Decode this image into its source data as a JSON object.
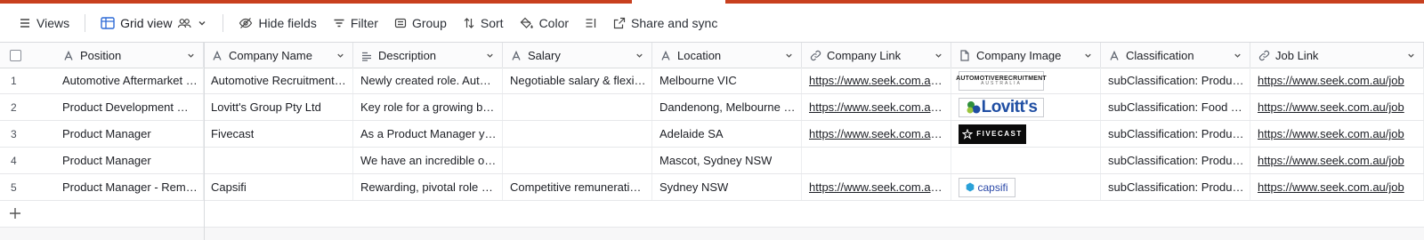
{
  "toolbar": {
    "views": "Views",
    "grid_view": "Grid view",
    "hide_fields": "Hide fields",
    "filter": "Filter",
    "group": "Group",
    "sort": "Sort",
    "color": "Color",
    "share_sync": "Share and sync"
  },
  "colors": {
    "accent": "#c8401f",
    "border": "#d9dbde",
    "grid_icon": "#2d6ad6"
  },
  "columns": [
    {
      "label": "Position",
      "icon": "text-type-icon"
    },
    {
      "label": "Company Name",
      "icon": "text-type-icon"
    },
    {
      "label": "Description",
      "icon": "long-text-icon"
    },
    {
      "label": "Salary",
      "icon": "text-type-icon"
    },
    {
      "label": "Location",
      "icon": "text-type-icon"
    },
    {
      "label": "Company Link",
      "icon": "link-icon"
    },
    {
      "label": "Company Image",
      "icon": "file-icon"
    },
    {
      "label": "Classification",
      "icon": "text-type-icon"
    },
    {
      "label": "Job Link",
      "icon": "link-icon"
    }
  ],
  "rows": [
    {
      "num": "1",
      "position": "Automotive Aftermarket - Product Manager",
      "company": "Automotive Recruitment Australia",
      "description": "Newly created role. Automotive aftermarket",
      "salary": "Negotiable salary & flexible conditions",
      "location": "Melbourne VIC",
      "company_link": "https://www.seek.com.au/companies",
      "image": {
        "kind": "auto",
        "text": "AUTOMOTIVERECRUITMENT",
        "subtext": "AUSTRALIA"
      },
      "classification": "subClassification: Product Management",
      "job_link": "https://www.seek.com.au/job"
    },
    {
      "num": "2",
      "position": "Product Development Manager",
      "company": "Lovitt's Group Pty Ltd",
      "description": "Key role for a growing business",
      "salary": "",
      "location": "Dandenong, Melbourne VIC",
      "company_link": "https://www.seek.com.au/companies",
      "image": {
        "kind": "lovitts",
        "text": "Lovitt's"
      },
      "classification": "subClassification: Food Technology",
      "job_link": "https://www.seek.com.au/job"
    },
    {
      "num": "3",
      "position": "Product Manager",
      "company": "Fivecast",
      "description": "As a Product Manager you will",
      "salary": "",
      "location": "Adelaide SA",
      "company_link": "https://www.seek.com.au/companies",
      "image": {
        "kind": "fivecast",
        "text": "FIVECAST"
      },
      "classification": "subClassification: Product Management",
      "job_link": "https://www.seek.com.au/job"
    },
    {
      "num": "4",
      "position": "Product Manager",
      "company": "",
      "description": "We have an incredible opportunity",
      "salary": "",
      "location": "Mascot, Sydney NSW",
      "company_link": "",
      "image": null,
      "classification": "subClassification: Product Management",
      "job_link": "https://www.seek.com.au/job"
    },
    {
      "num": "5",
      "position": "Product Manager - Remote",
      "company": "Capsifi",
      "description": "Rewarding, pivotal role with impact",
      "salary": "Competitive remuneration package",
      "location": "Sydney NSW",
      "company_link": "https://www.seek.com.au/companies",
      "image": {
        "kind": "capsifi",
        "text": "capsifi"
      },
      "classification": "subClassification: Product Management",
      "job_link": "https://www.seek.com.au/job"
    }
  ]
}
